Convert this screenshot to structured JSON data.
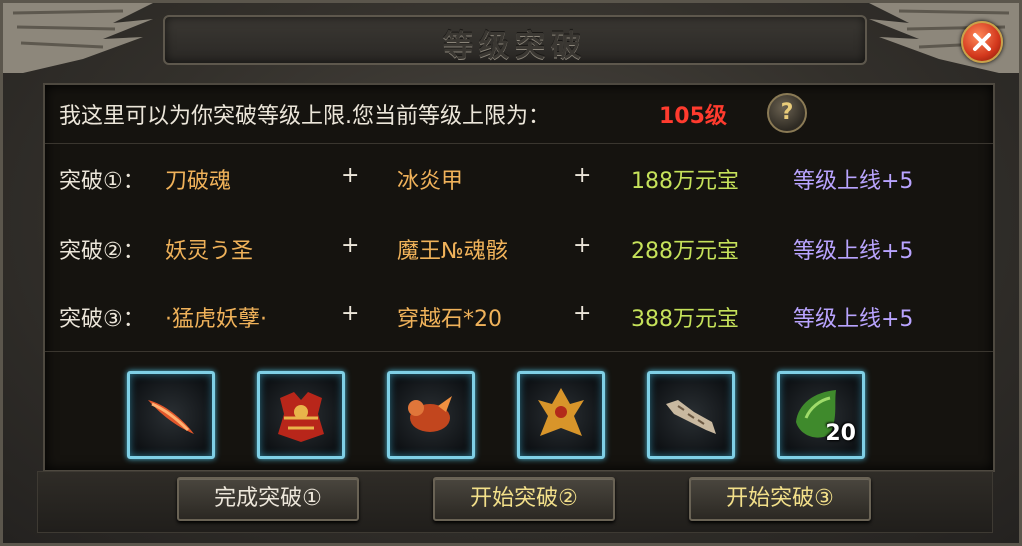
{
  "title": "等级突破",
  "info": {
    "text": "我这里可以为你突破等级上限.您当前等级上限为：",
    "current_limit": "105级",
    "help_glyph": "?"
  },
  "recipes": [
    {
      "label": "突破①：",
      "item1": "刀破魂",
      "plus": "+",
      "item2": "冰炎甲",
      "cost": "188万元宝",
      "bonus": "等级上线+5"
    },
    {
      "label": "突破②：",
      "item1": "妖灵う圣",
      "plus": "+",
      "item2": "魔王№魂骸",
      "cost": "288万元宝",
      "bonus": "等级上线+5"
    },
    {
      "label": "突破③：",
      "item1": "·猛虎妖孽·",
      "plus": "+",
      "item2": "穿越石*20",
      "cost": "388万元宝",
      "bonus": "等级上线+5"
    }
  ],
  "items": [
    {
      "icon": "blade-item-icon"
    },
    {
      "icon": "demon-armor-item-icon"
    },
    {
      "icon": "fire-beast-item-icon"
    },
    {
      "icon": "golden-demon-item-icon"
    },
    {
      "icon": "tiger-item-icon"
    },
    {
      "icon": "green-stone-item-icon",
      "quantity": "20"
    }
  ],
  "buttons": {
    "complete": "完成突破①",
    "start2": "开始突破②",
    "start3": "开始突破③"
  },
  "colors": {
    "item_name": "#f0b25a",
    "cost": "#c6e25a",
    "bonus": "#b9a4ff",
    "limit": "#ff3b2e"
  }
}
